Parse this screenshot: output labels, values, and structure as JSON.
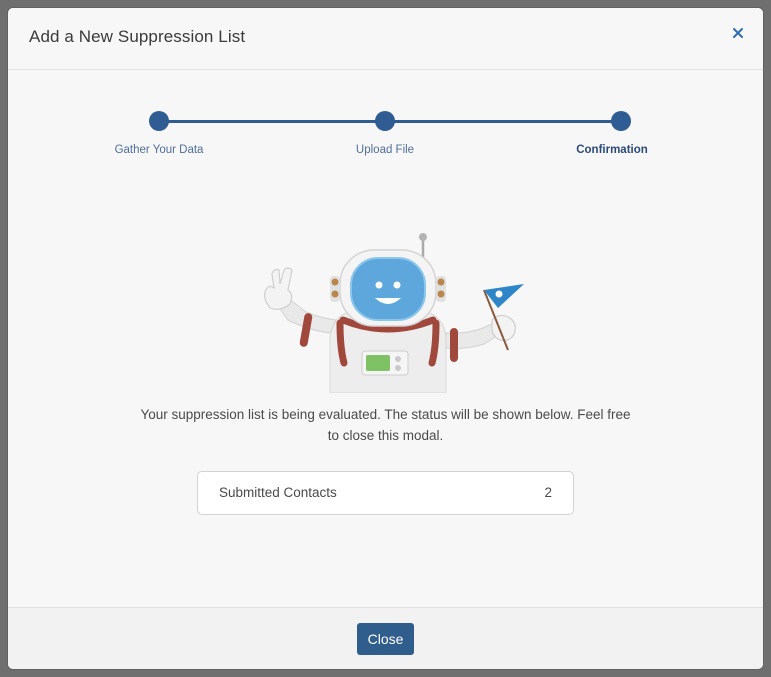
{
  "modal": {
    "title": "Add a New Suppression List",
    "close_icon": "close-icon"
  },
  "stepper": {
    "steps": [
      {
        "label": "Gather Your Data",
        "state": "complete"
      },
      {
        "label": "Upload File",
        "state": "complete"
      },
      {
        "label": "Confirmation",
        "state": "active"
      }
    ],
    "accent_color": "#2f5d93"
  },
  "illustration": {
    "icon": "astronaut-celebration-illustration"
  },
  "message": "Your suppression list is being evaluated. The status will be shown below. Feel free to close this modal.",
  "summary": {
    "label": "Submitted Contacts",
    "value": "2"
  },
  "footer": {
    "close_label": "Close",
    "button_color": "#2f5d8c"
  }
}
